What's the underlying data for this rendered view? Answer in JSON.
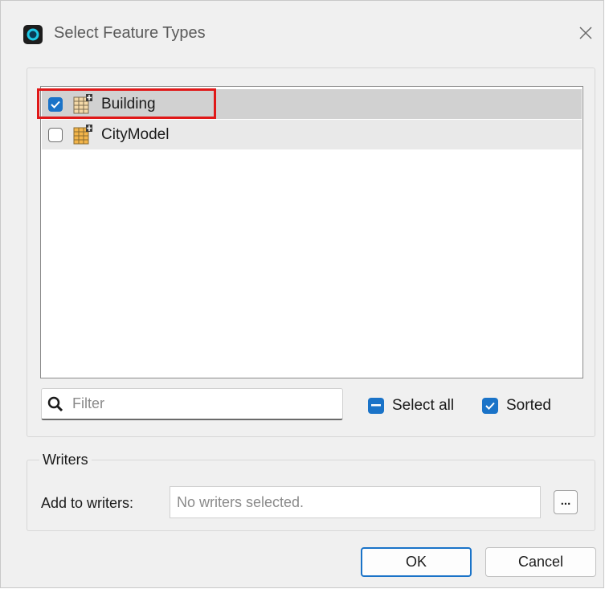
{
  "window": {
    "title": "Select Feature Types"
  },
  "feature_list": {
    "items": [
      {
        "label": "Building",
        "checked": true,
        "icon": "feature-type-table-icon"
      },
      {
        "label": "CityModel",
        "checked": false,
        "icon": "feature-type-table-icon"
      }
    ]
  },
  "filter": {
    "placeholder": "Filter",
    "value": ""
  },
  "options": {
    "select_all_label": "Select all",
    "select_all_state": "indeterminate",
    "sorted_label": "Sorted",
    "sorted_checked": true
  },
  "writers": {
    "group_label": "Writers",
    "add_label": "Add to writers:",
    "placeholder": "No writers selected.",
    "browse_label": "..."
  },
  "buttons": {
    "ok": "OK",
    "cancel": "Cancel"
  },
  "colors": {
    "accent": "#1a73c8",
    "highlight": "#e01818",
    "selected_row": "#d1d1d1"
  }
}
